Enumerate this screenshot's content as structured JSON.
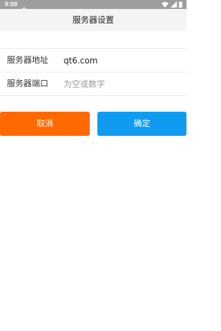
{
  "status_bar": {
    "time": "9:59"
  },
  "header": {
    "title": "服务器设置"
  },
  "form": {
    "address": {
      "label": "服务器地址",
      "value": "qt6.com"
    },
    "port": {
      "label": "服务器端口",
      "value": "",
      "placeholder": "为空或数字"
    }
  },
  "actions": {
    "cancel_label": "取消",
    "confirm_label": "确定"
  },
  "colors": {
    "status_bar_bg": "#9e9e9e",
    "title_bar_bg": "#f4f4f4",
    "cancel_button_bg": "#ff6a00",
    "confirm_button_bg": "#109bf0",
    "placeholder_text": "#9a9a9a"
  },
  "icons": {
    "status_left": "cast-icon",
    "status_right": [
      "wifi-icon",
      "cellular-signal-icon",
      "battery-icon"
    ]
  }
}
